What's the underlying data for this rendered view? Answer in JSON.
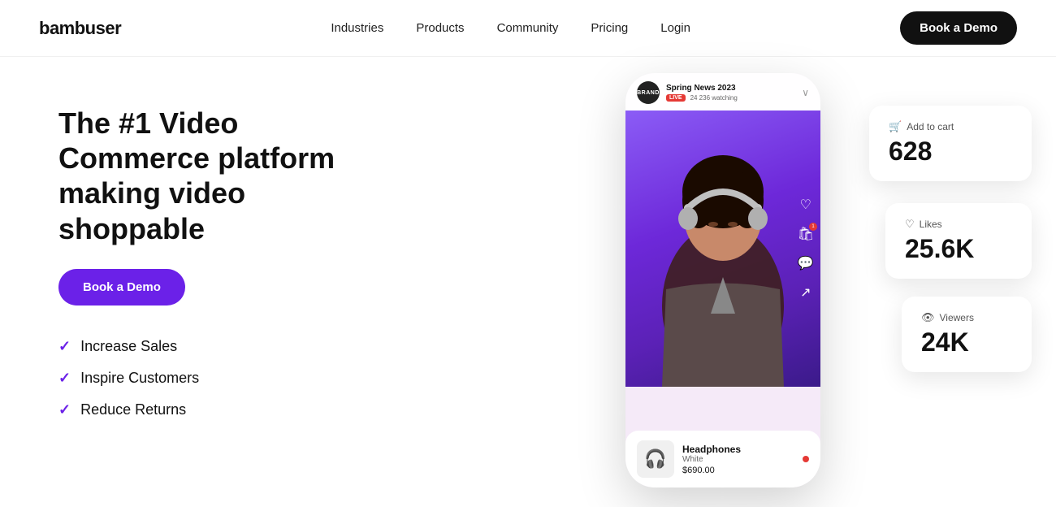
{
  "brand": {
    "name": "bambuser"
  },
  "nav": {
    "links": [
      {
        "label": "Industries",
        "href": "#"
      },
      {
        "label": "Products",
        "href": "#"
      },
      {
        "label": "Community",
        "href": "#"
      },
      {
        "label": "Pricing",
        "href": "#"
      },
      {
        "label": "Login",
        "href": "#"
      }
    ],
    "cta": "Book a Demo"
  },
  "hero": {
    "headline": "The #1 Video Commerce platform making video shoppable",
    "cta": "Book a Demo",
    "features": [
      "Increase Sales",
      "Inspire Customers",
      "Reduce Returns"
    ]
  },
  "phone": {
    "stream_title": "Spring News 2023",
    "live_label": "LIVE",
    "watching": "24 236 watching",
    "brand_label": "BRAND"
  },
  "product": {
    "name": "Headphones",
    "variant": "White",
    "price": "$690.00"
  },
  "stats": {
    "add_to_cart_label": "Add to cart",
    "add_to_cart_value": "628",
    "likes_label": "Likes",
    "likes_value": "25.6K",
    "viewers_label": "Viewers",
    "viewers_value": "24K"
  }
}
